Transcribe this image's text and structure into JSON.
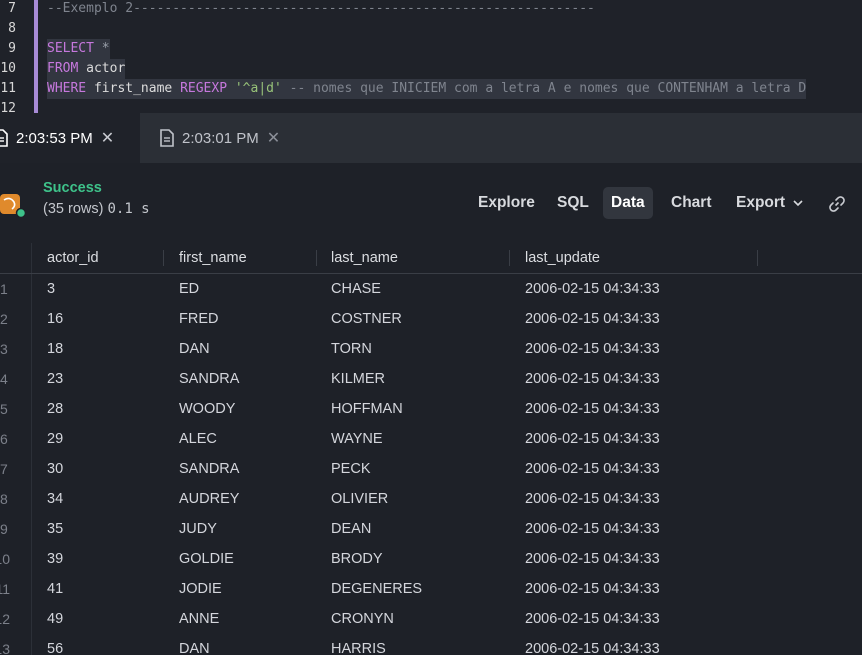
{
  "editor": {
    "lines": [
      {
        "n": "7",
        "segments": [
          {
            "t": "--Exemplo 2-----------------------------------------------------------",
            "c": "comment"
          }
        ]
      },
      {
        "n": "8",
        "segments": []
      },
      {
        "n": "9",
        "segments": [
          {
            "t": "SELECT",
            "c": "kw"
          },
          {
            "t": " ",
            "c": ""
          },
          {
            "t": "*",
            "c": "op"
          }
        ],
        "highlight": true
      },
      {
        "n": "10",
        "segments": [
          {
            "t": "FROM",
            "c": "kw"
          },
          {
            "t": " actor",
            "c": ""
          }
        ],
        "highlight": true
      },
      {
        "n": "11",
        "segments": [
          {
            "t": "WHERE",
            "c": "kw"
          },
          {
            "t": " first_name ",
            "c": ""
          },
          {
            "t": "REGEXP",
            "c": "kw"
          },
          {
            "t": " ",
            "c": ""
          },
          {
            "t": "'^a|d'",
            "c": "str"
          },
          {
            "t": " -- nomes que INICIEM com a letra A e nomes que CONTENHAM a letra D",
            "c": "comment"
          }
        ],
        "highlight": true
      },
      {
        "n": "12",
        "segments": []
      }
    ]
  },
  "tabs": [
    {
      "label": "2:03:53 PM",
      "active": true
    },
    {
      "label": "2:03:01 PM",
      "active": false
    }
  ],
  "status": {
    "title": "Success",
    "rows_text": "(35 rows)",
    "time_text": "0.1 s"
  },
  "toolbar": {
    "explore": "Explore",
    "sql": "SQL",
    "data": "Data",
    "chart": "Chart",
    "export": "Export"
  },
  "table": {
    "columns": [
      "actor_id",
      "first_name",
      "last_name",
      "last_update"
    ],
    "rows": [
      {
        "rn": "1",
        "cells": [
          "3",
          "ED",
          "CHASE",
          "2006-02-15 04:34:33"
        ]
      },
      {
        "rn": "2",
        "cells": [
          "16",
          "FRED",
          "COSTNER",
          "2006-02-15 04:34:33"
        ]
      },
      {
        "rn": "3",
        "cells": [
          "18",
          "DAN",
          "TORN",
          "2006-02-15 04:34:33"
        ]
      },
      {
        "rn": "4",
        "cells": [
          "23",
          "SANDRA",
          "KILMER",
          "2006-02-15 04:34:33"
        ]
      },
      {
        "rn": "5",
        "cells": [
          "28",
          "WOODY",
          "HOFFMAN",
          "2006-02-15 04:34:33"
        ]
      },
      {
        "rn": "6",
        "cells": [
          "29",
          "ALEC",
          "WAYNE",
          "2006-02-15 04:34:33"
        ]
      },
      {
        "rn": "7",
        "cells": [
          "30",
          "SANDRA",
          "PECK",
          "2006-02-15 04:34:33"
        ]
      },
      {
        "rn": "8",
        "cells": [
          "34",
          "AUDREY",
          "OLIVIER",
          "2006-02-15 04:34:33"
        ]
      },
      {
        "rn": "9",
        "cells": [
          "35",
          "JUDY",
          "DEAN",
          "2006-02-15 04:34:33"
        ]
      },
      {
        "rn": "10",
        "cells": [
          "39",
          "GOLDIE",
          "BRODY",
          "2006-02-15 04:34:33"
        ]
      },
      {
        "rn": "11",
        "cells": [
          "41",
          "JODIE",
          "DEGENERES",
          "2006-02-15 04:34:33"
        ]
      },
      {
        "rn": "12",
        "cells": [
          "49",
          "ANNE",
          "CRONYN",
          "2006-02-15 04:34:33"
        ]
      },
      {
        "rn": "13",
        "cells": [
          "56",
          "DAN",
          "HARRIS",
          "2006-02-15 04:34:33"
        ]
      }
    ]
  },
  "colors": {
    "success": "#3ec28a",
    "keyword": "#c678dd",
    "string": "#98c379",
    "comment": "#7f848e",
    "db_icon": "#e08a2c"
  },
  "icons": {
    "tab_active": "file-icon",
    "tab_inactive": "file-icon",
    "close": "close-icon",
    "database": "database-icon",
    "export_chevron": "chevron-down-icon",
    "link": "link-icon"
  }
}
